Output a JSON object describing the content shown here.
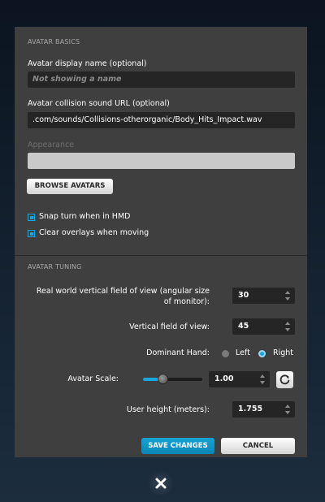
{
  "avatar_basics": {
    "section_title": "AVATAR BASICS",
    "display_name_label": "Avatar display name (optional)",
    "display_name_placeholder": "Not showing a name",
    "collision_sound_label": "Avatar collision sound URL (optional)",
    "collision_sound_value": ".com/sounds/Collisions-otherorganic/Body_Hits_Impact.wav",
    "appearance_label": "Appearance",
    "appearance_value": "",
    "browse_avatars_label": "BROWSE AVATARS",
    "snap_turn_label": "Snap turn when in HMD",
    "snap_turn_checked": true,
    "clear_overlays_label": "Clear overlays when moving",
    "clear_overlays_checked": true
  },
  "avatar_tuning": {
    "section_title": "AVATAR TUNING",
    "real_world_fov_label": "Real world vertical field of view (angular size of monitor):",
    "real_world_fov_value": "30",
    "vertical_fov_label": "Vertical field of view:",
    "vertical_fov_value": "45",
    "dominant_hand_label": "Dominant Hand:",
    "hand_left_label": "Left",
    "hand_right_label": "Right",
    "dominant_hand_selected": "Right",
    "avatar_scale_label": "Avatar Scale:",
    "avatar_scale_value": "1.00",
    "avatar_scale_slider_fraction": 0.33,
    "user_height_label": "User height (meters):",
    "user_height_value": "1.755"
  },
  "footer": {
    "save_label": "SAVE CHANGES",
    "cancel_label": "CANCEL"
  },
  "icons": {
    "reset": "reset-icon",
    "close": "close-icon"
  },
  "colors": {
    "accent": "#15a7df",
    "panel": "#3f3f3f",
    "field": "#252525"
  }
}
